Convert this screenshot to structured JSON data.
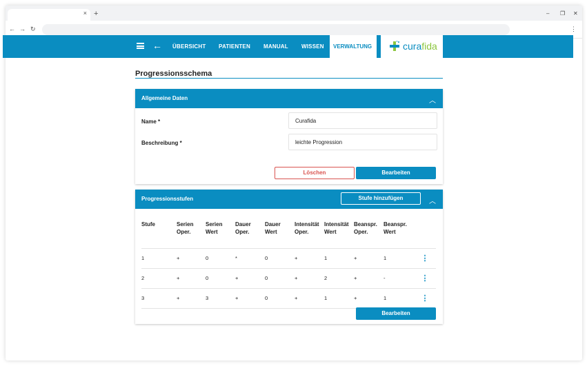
{
  "browser": {
    "tab_close": "×",
    "new_tab": "+",
    "minimize": "–",
    "restore": "❐",
    "close": "✕",
    "back": "←",
    "forward": "→",
    "reload": "↻",
    "menu": "⋮"
  },
  "appbar": {
    "back_icon": "←",
    "nav": [
      "ÜBERSICHT",
      "PATIENTEN",
      "MANUAL",
      "WISSEN"
    ],
    "active_nav": "VERWALTUNG",
    "logo_part1": "cura",
    "logo_part2": "fida"
  },
  "page": {
    "title": "Progressionsschema"
  },
  "general": {
    "header": "Allgemeine Daten",
    "collapse_icon": "︿",
    "name_label": "Name *",
    "name_value": "Curafida",
    "description_label": "Beschreibung *",
    "description_value": "leichte Progression",
    "delete_label": "Löschen",
    "edit_label": "Bearbeiten"
  },
  "stages": {
    "header": "Progressionsstufen",
    "add_label": "Stufe hinzufügen",
    "collapse_icon": "︿",
    "columns": [
      [
        "Stufe",
        ""
      ],
      [
        "Serien",
        "Oper."
      ],
      [
        "Serien",
        "Wert"
      ],
      [
        "Dauer",
        "Oper."
      ],
      [
        "Dauer",
        "Wert"
      ],
      [
        "Intensität",
        "Oper."
      ],
      [
        "Intensität",
        "Wert"
      ],
      [
        "Beanspr.",
        "Oper."
      ],
      [
        "Beanspr.",
        "Wert"
      ]
    ],
    "rows": [
      [
        "1",
        "+",
        "0",
        "*",
        "0",
        "+",
        "1",
        "+",
        "1"
      ],
      [
        "2",
        "+",
        "0",
        "+",
        "0",
        "+",
        "2",
        "+",
        "-"
      ],
      [
        "3",
        "+",
        "3",
        "+",
        "0",
        "+",
        "1",
        "+",
        "1"
      ]
    ],
    "row_menu_icon": "⋮",
    "edit_label": "Bearbeiten"
  },
  "colors": {
    "primary": "#0a8dc1",
    "danger": "#d9534f",
    "logo_green": "#8cc63f"
  }
}
